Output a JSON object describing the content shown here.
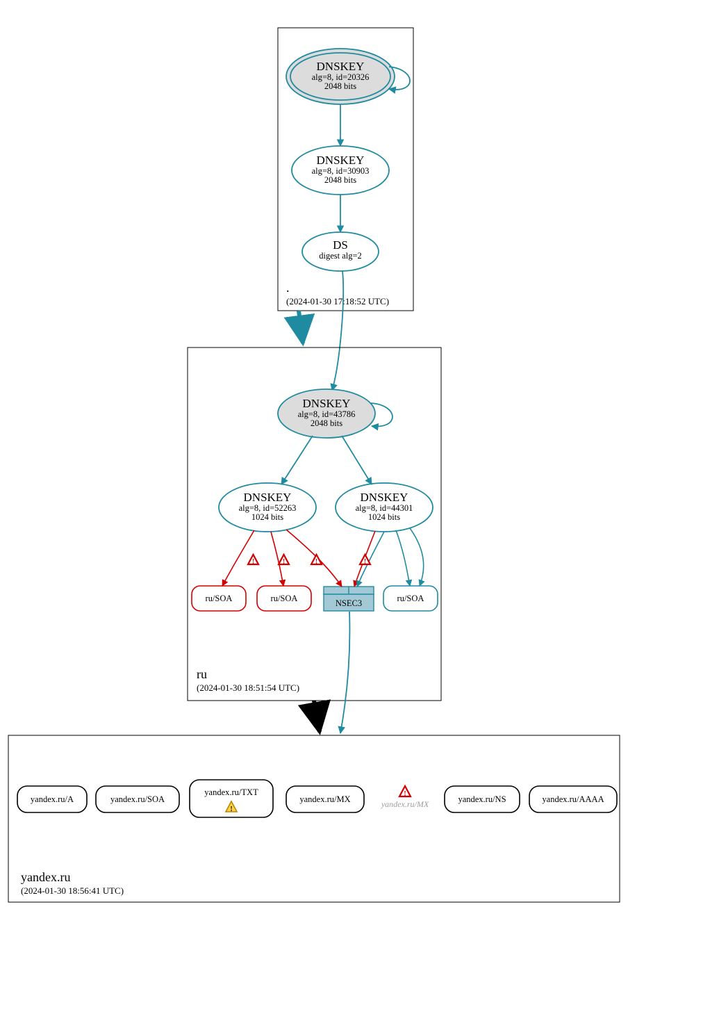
{
  "colors": {
    "teal": "#1f8ba0",
    "red": "#d30000",
    "black": "#000000",
    "grey": "#dcdcdc",
    "nsec": "#a3c9d6",
    "warnFill": "#ffd24a",
    "ghost": "#9c9c9c"
  },
  "zones": {
    "root": {
      "label": ".",
      "time": "(2024-01-30 17:18:52 UTC)",
      "nodes": {
        "ksk": {
          "title": "DNSKEY",
          "line1": "alg=8, id=20326",
          "line2": "2048 bits"
        },
        "zsk": {
          "title": "DNSKEY",
          "line1": "alg=8, id=30903",
          "line2": "2048 bits"
        },
        "ds": {
          "title": "DS",
          "line1": "digest alg=2"
        }
      }
    },
    "ru": {
      "label": "ru",
      "time": "(2024-01-30 18:51:54 UTC)",
      "nodes": {
        "ksk": {
          "title": "DNSKEY",
          "line1": "alg=8, id=43786",
          "line2": "2048 bits"
        },
        "zsk1": {
          "title": "DNSKEY",
          "line1": "alg=8, id=52263",
          "line2": "1024 bits"
        },
        "zsk2": {
          "title": "DNSKEY",
          "line1": "alg=8, id=44301",
          "line2": "1024 bits"
        },
        "soa1": {
          "label": "ru/SOA"
        },
        "soa2": {
          "label": "ru/SOA"
        },
        "nsec3": {
          "label": "NSEC3"
        },
        "soa3": {
          "label": "ru/SOA"
        }
      }
    },
    "yandex": {
      "label": "yandex.ru",
      "time": "(2024-01-30 18:56:41 UTC)",
      "records": {
        "a": {
          "label": "yandex.ru/A"
        },
        "soa": {
          "label": "yandex.ru/SOA"
        },
        "txt": {
          "label": "yandex.ru/TXT"
        },
        "mx": {
          "label": "yandex.ru/MX"
        },
        "mx2": {
          "label": "yandex.ru/MX"
        },
        "ns": {
          "label": "yandex.ru/NS"
        },
        "aaaa": {
          "label": "yandex.ru/AAAA"
        }
      }
    }
  }
}
